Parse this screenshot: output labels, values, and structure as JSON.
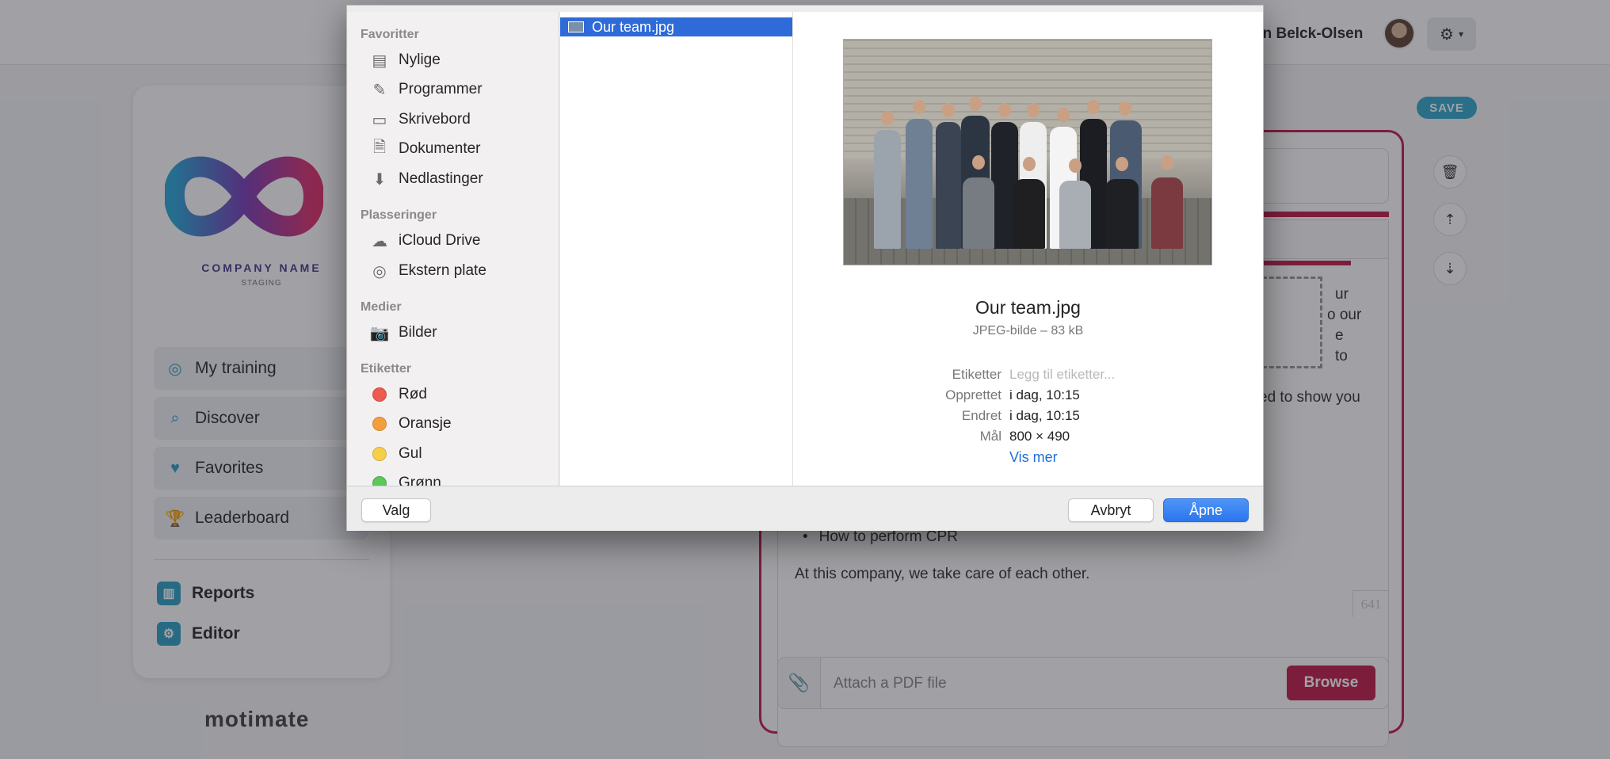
{
  "header": {
    "user_name": "nn Belck-Olsen",
    "settings_icon": "gear-icon"
  },
  "sidebar": {
    "company_name": "COMPANY NAME",
    "environment": "STAGING",
    "nav": [
      {
        "label": "My training",
        "icon": "target-icon"
      },
      {
        "label": "Discover",
        "icon": "search-icon"
      },
      {
        "label": "Favorites",
        "icon": "heart-icon"
      },
      {
        "label": "Leaderboard",
        "icon": "trophy-icon"
      }
    ],
    "admin": [
      {
        "label": "Reports",
        "icon": "bar-chart-icon"
      },
      {
        "label": "Editor",
        "icon": "gear-icon"
      }
    ],
    "brand": "motimate"
  },
  "editor": {
    "save_label": "SAVE",
    "tab_fragment": "e",
    "text_fragments": [
      "ur",
      "o our",
      "e",
      "to",
      "ed to show you"
    ],
    "bullet": "How to perform CPR",
    "paragraph": "At this company, we take care of each other.",
    "char_count": "641",
    "attach_placeholder": "Attach a PDF file",
    "browse_label": "Browse"
  },
  "dialog": {
    "sections": [
      {
        "heading": "Favoritter",
        "items": [
          {
            "label": "Nylige",
            "icon": "recents-icon"
          },
          {
            "label": "Programmer",
            "icon": "applications-icon"
          },
          {
            "label": "Skrivebord",
            "icon": "desktop-icon"
          },
          {
            "label": "Dokumenter",
            "icon": "document-icon"
          },
          {
            "label": "Nedlastinger",
            "icon": "download-icon"
          }
        ]
      },
      {
        "heading": "Plasseringer",
        "items": [
          {
            "label": "iCloud Drive",
            "icon": "cloud-icon"
          },
          {
            "label": "Ekstern plate",
            "icon": "disk-icon"
          }
        ]
      },
      {
        "heading": "Medier",
        "items": [
          {
            "label": "Bilder",
            "icon": "camera-icon"
          }
        ]
      },
      {
        "heading": "Etiketter",
        "items": [
          {
            "label": "Rød",
            "color": "#ec5a50"
          },
          {
            "label": "Oransje",
            "color": "#f3a03c"
          },
          {
            "label": "Gul",
            "color": "#f6cf48"
          },
          {
            "label": "Grønn",
            "color": "#5cc75a"
          }
        ]
      }
    ],
    "selected_file": "Our team.jpg",
    "preview": {
      "name": "Our team.jpg",
      "kind": "JPEG-bilde – 83 kB",
      "meta": [
        {
          "key": "Etiketter",
          "value": "Legg til etiketter...",
          "placeholder": true
        },
        {
          "key": "Opprettet",
          "value": "i dag, 10:15"
        },
        {
          "key": "Endret",
          "value": "i dag, 10:15"
        },
        {
          "key": "Mål",
          "value": "800 × 490"
        }
      ],
      "more_link": "Vis mer"
    },
    "buttons": {
      "options": "Valg",
      "cancel": "Avbryt",
      "open": "Åpne"
    },
    "accent_color": "#2e6bd9"
  }
}
